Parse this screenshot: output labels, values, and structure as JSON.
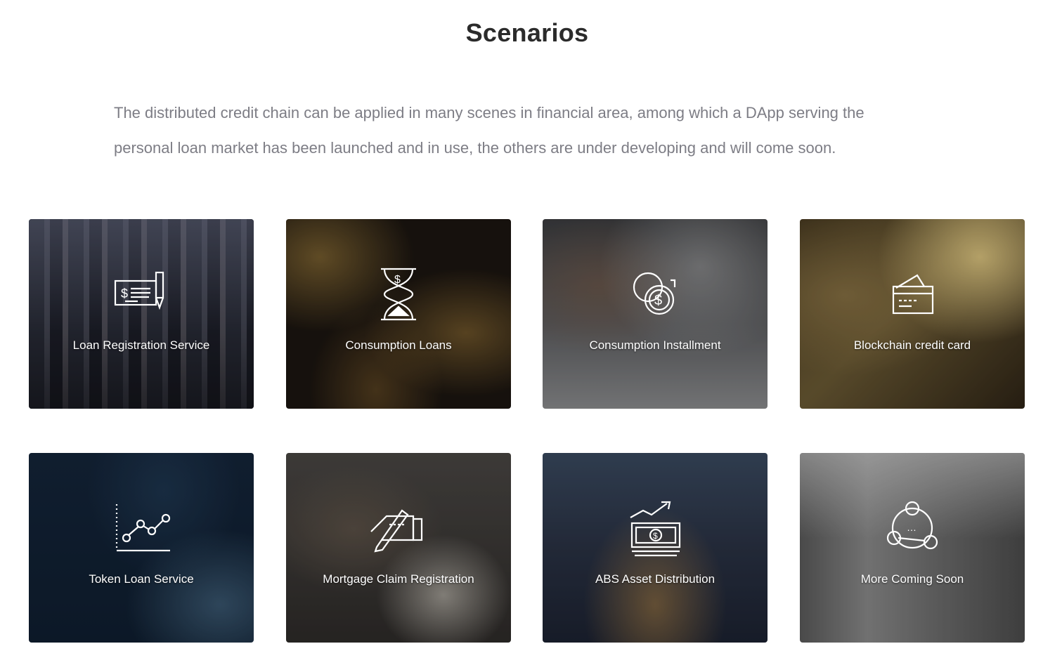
{
  "section": {
    "title": "Scenarios",
    "intro_line1": "The distributed credit chain can be applied in many scenes in financial area, among which a DApp serving the",
    "intro_line2": "personal loan market has been launched and in use, the others are under developing and will come soon."
  },
  "cards": [
    {
      "label": "Loan Registration Service",
      "icon": "cheque-pen-icon"
    },
    {
      "label": "Consumption Loans",
      "icon": "hourglass-dollar-icon"
    },
    {
      "label": "Consumption Installment",
      "icon": "coins-icon"
    },
    {
      "label": "Blockchain credit card",
      "icon": "credit-card-icon"
    },
    {
      "label": "Token Loan Service",
      "icon": "line-chart-icon"
    },
    {
      "label": "Mortgage Claim Registration",
      "icon": "signing-hand-icon"
    },
    {
      "label": "ABS Asset Distribution",
      "icon": "cash-growth-icon"
    },
    {
      "label": "More Coming Soon",
      "icon": "network-nodes-icon"
    }
  ]
}
